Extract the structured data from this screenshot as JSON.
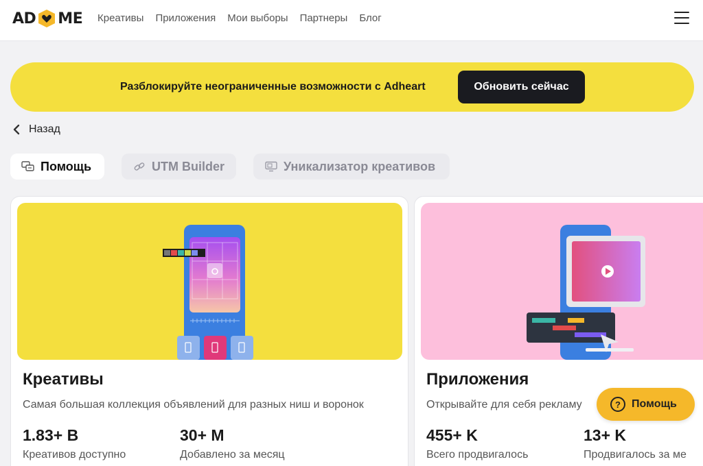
{
  "header": {
    "logo_left": "AD",
    "logo_right": "ME",
    "nav": [
      "Креативы",
      "Приложения",
      "Мои выборы",
      "Партнеры",
      "Блог"
    ]
  },
  "promo": {
    "text": "Разблокируйте неограниченные возможности с Adheart",
    "button": "Обновить сейчас"
  },
  "back_label": "Назад",
  "tabs": [
    {
      "label": "Помощь",
      "icon": "chat-icon",
      "active": true
    },
    {
      "label": "UTM Builder",
      "icon": "link-icon",
      "active": false
    },
    {
      "label": "Уникализатор креативов",
      "icon": "monitor-icon",
      "active": false
    }
  ],
  "cards": [
    {
      "title": "Креативы",
      "description": "Самая большая коллекция объявлений для разных ниш и воронок",
      "stats": [
        {
          "value": "1.83+ B",
          "label": "Креативов доступно"
        },
        {
          "value": "30+ M",
          "label": "Добавлено за месяц"
        }
      ],
      "color": "#f4df3e"
    },
    {
      "title": "Приложения",
      "description": "Открывайте для себя рекламу",
      "stats": [
        {
          "value": "455+ K",
          "label": "Всего продвигалось"
        },
        {
          "value": "13+ K",
          "label": "Продвигалось за ме"
        }
      ],
      "color": "#fdbfdc"
    }
  ],
  "help_button": {
    "label": "Помощь",
    "icon_glyph": "?"
  },
  "colors": {
    "accent": "#f4df3e",
    "help": "#f5b82a",
    "dark": "#1a1b20"
  }
}
